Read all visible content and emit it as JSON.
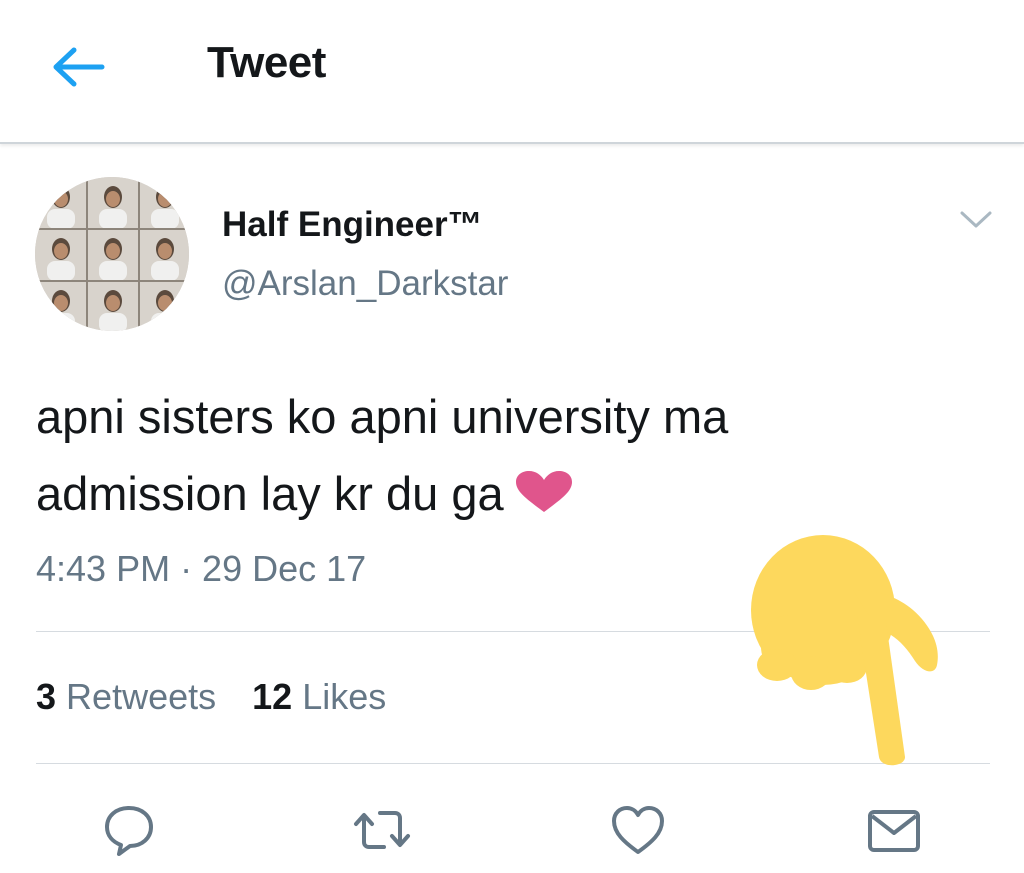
{
  "header": {
    "title": "Tweet",
    "back_icon": "arrow-left-icon",
    "accent_color": "#1da1f2"
  },
  "tweet": {
    "author": {
      "display_name": "Half Engineer™",
      "handle": "@Arslan_Darkstar"
    },
    "text_line_1": "apni sisters ko apni university ma",
    "text_line_2": "admission lay kr du ga",
    "emoji": "pink-heart",
    "emoji_color": "#e0558c",
    "timestamp": "4:43 PM · 29 Dec 17",
    "stats": {
      "retweets_count": "3",
      "retweets_label": "Retweets",
      "likes_count": "12",
      "likes_label": "Likes"
    }
  },
  "actions": [
    {
      "name": "reply",
      "icon": "reply-bubble-icon"
    },
    {
      "name": "retweet",
      "icon": "retweet-icon"
    },
    {
      "name": "like",
      "icon": "heart-outline-icon"
    },
    {
      "name": "dm",
      "icon": "envelope-icon"
    }
  ],
  "overlay": {
    "icon": "pointing-finger-down-icon",
    "color": "#fdd85d"
  }
}
